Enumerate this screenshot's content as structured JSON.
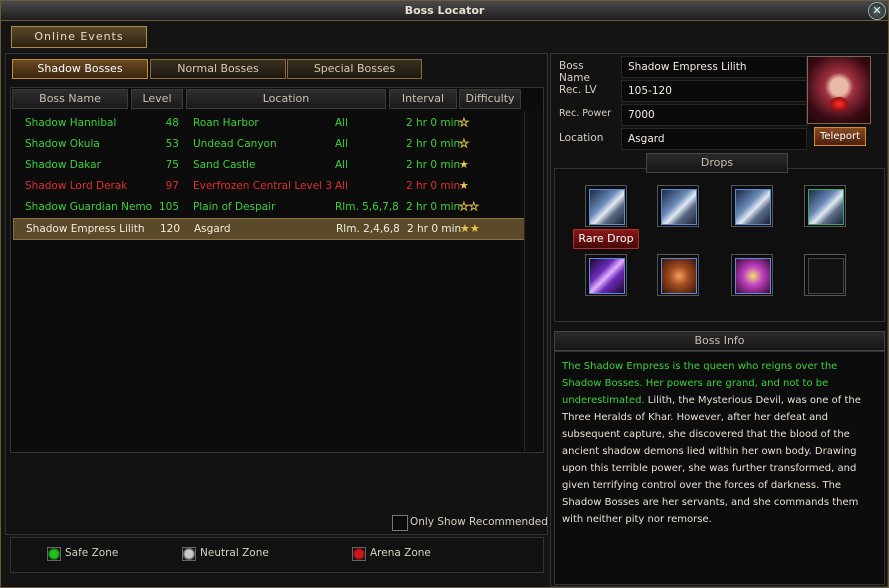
{
  "window": {
    "title": "Boss Locator",
    "close_glyph": "✕"
  },
  "online_events_label": "Online Events",
  "tabs": [
    {
      "label": "Shadow Bosses",
      "active": true
    },
    {
      "label": "Normal Bosses",
      "active": false
    },
    {
      "label": "Special Bosses",
      "active": false
    }
  ],
  "table": {
    "headers": [
      "Boss Name",
      "Level",
      "Location",
      "Interval",
      "Difficulty"
    ],
    "rows": [
      {
        "name": "Shadow Hannibal",
        "level": "48",
        "location": "Roan Harbor",
        "realm": "All",
        "interval": "2 hr 0 min",
        "color": "green",
        "stars": 1,
        "star_style": "empty"
      },
      {
        "name": "Shadow Okula",
        "level": "53",
        "location": "Undead Canyon",
        "realm": "All",
        "interval": "2 hr 0 min",
        "color": "green",
        "stars": 1,
        "star_style": "empty"
      },
      {
        "name": "Shadow Dakar",
        "level": "75",
        "location": "Sand Castle",
        "realm": "All",
        "interval": "2 hr 0 min",
        "color": "green",
        "stars": 1,
        "star_style": "filled"
      },
      {
        "name": "Shadow Lord Derak",
        "level": "97",
        "location": "Everfrozen Central Level 3",
        "realm": "All",
        "interval": "2 hr 0 min",
        "color": "red",
        "stars": 1,
        "star_style": "filled"
      },
      {
        "name": "Shadow Guardian Nemo",
        "level": "105",
        "location": "Plain of Despair",
        "realm": "Rlm. 5,6,7,8",
        "interval": "2 hr 0 min",
        "color": "green",
        "stars": 2,
        "star_style": "empty"
      },
      {
        "name": "Shadow Empress Lilith",
        "level": "120",
        "location": "Asgard",
        "realm": "Rlm. 2,4,6,8",
        "interval": "2 hr 0 min",
        "color": "white",
        "stars": 2,
        "star_style": "filled",
        "selected": true
      }
    ]
  },
  "only_show_recommended_label": "Only Show Recommended",
  "legend": [
    {
      "label": "Safe Zone",
      "color": "#20c020"
    },
    {
      "label": "Neutral Zone",
      "color": "#c8c8c8"
    },
    {
      "label": "Arena Zone",
      "color": "#d01818"
    }
  ],
  "details": {
    "boss_name_label": "Boss Name",
    "boss_name": "Shadow Empress Lilith",
    "rec_lv_label": "Rec. LV",
    "rec_lv": "105-120",
    "rec_power_label": "Rec. Power",
    "rec_power": "7000",
    "location_label": "Location",
    "location": "Asgard",
    "teleport_label": "Teleport"
  },
  "drops": {
    "title": "Drops",
    "rare_drop_label": "Rare Drop",
    "items": [
      {
        "icon": "gauntlet-icon",
        "frame": "#5a8ad8"
      },
      {
        "icon": "gauntlet-icon",
        "frame": "#5a8ad8"
      },
      {
        "icon": "gauntlet-icon",
        "frame": "#5a8ad8"
      },
      {
        "icon": "gauntlet-icon",
        "frame": "#3aa86a"
      },
      {
        "icon": "purple-blade-icon",
        "frame": "#5a8ad8"
      },
      {
        "icon": "ore-icon",
        "frame": "#5a8ad8"
      },
      {
        "icon": "purple-orb-icon",
        "frame": "#5a8ad8"
      },
      {
        "icon": "empty-slot",
        "frame": "#444"
      }
    ]
  },
  "boss_info": {
    "title": "Boss Info",
    "highlight": "The Shadow Empress is the queen who reigns over the Shadow Bosses. Her powers are grand, and not to be underestimated.",
    "body": "Lilith, the Mysterious Devil, was one of the Three Heralds of Khar. However, after her defeat and subsequent capture, she discovered that the blood of the ancient shadow demons lied within her own body. Drawing upon this terrible power, she was further transformed, and given terrifying control over the forces of darkness. The Shadow Bosses are her servants, and she commands them with neither pity nor remorse."
  }
}
